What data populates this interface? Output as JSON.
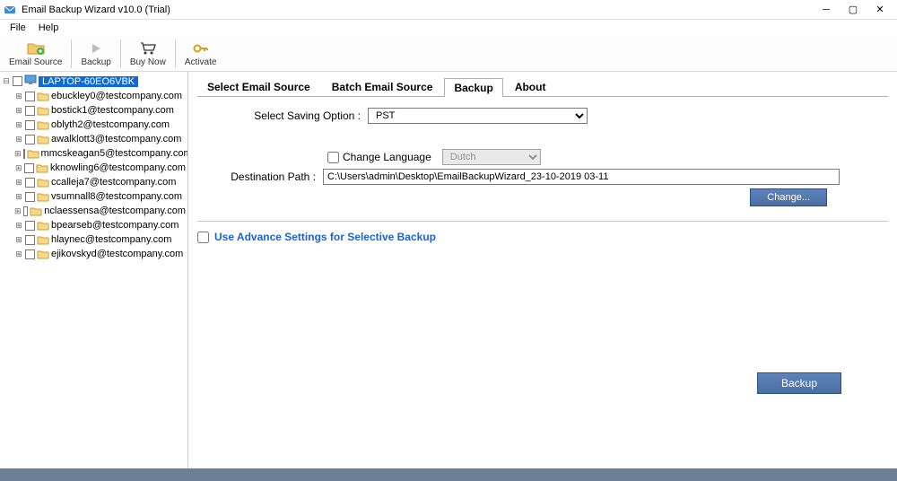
{
  "window": {
    "title": "Email Backup Wizard v10.0 (Trial)"
  },
  "menubar": {
    "file": "File",
    "help": "Help"
  },
  "toolbar": {
    "email_source": "Email Source",
    "backup": "Backup",
    "buy_now": "Buy Now",
    "activate": "Activate"
  },
  "tree": {
    "root": "LAPTOP-60EO6VBK",
    "items": [
      "ebuckley0@testcompany.com",
      "bostick1@testcompany.com",
      "oblyth2@testcompany.com",
      "awalklott3@testcompany.com",
      "mmcskeagan5@testcompany.com",
      "kknowling6@testcompany.com",
      "ccalleja7@testcompany.com",
      "vsumnall8@testcompany.com",
      "nclaessensa@testcompany.com",
      "bpearseb@testcompany.com",
      "hlaynec@testcompany.com",
      "ejikovskyd@testcompany.com"
    ]
  },
  "tabs": {
    "select_source": "Select Email Source",
    "batch_source": "Batch Email Source",
    "backup": "Backup",
    "about": "About"
  },
  "form": {
    "saving_option_label": "Select Saving Option :",
    "saving_option_value": "PST",
    "change_language_label": "Change Language",
    "language_value": "Dutch",
    "destination_label": "Destination Path :",
    "destination_value": "C:\\Users\\admin\\Desktop\\EmailBackupWizard_23-10-2019 03-11",
    "change_btn": "Change...",
    "advance_label": "Use Advance Settings for Selective Backup",
    "backup_btn": "Backup"
  }
}
